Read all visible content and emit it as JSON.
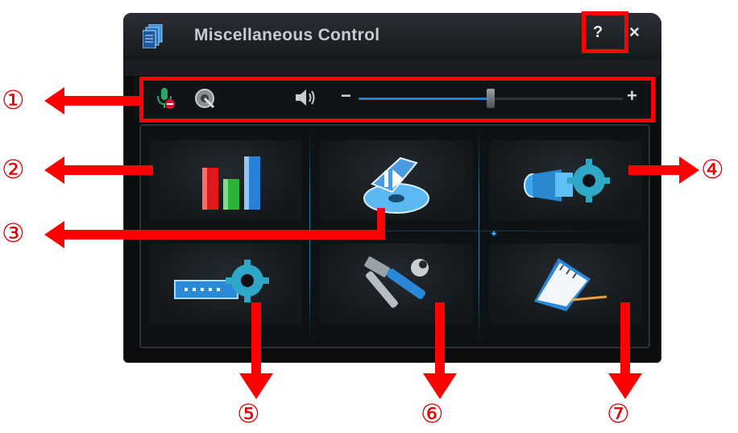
{
  "window": {
    "title": "Miscellaneous Control",
    "help_label": "?",
    "close_label": "×"
  },
  "toolbar": {
    "minus_label": "−",
    "plus_label": "+",
    "volume_level": 0.5
  },
  "callouts": {
    "c1": "①",
    "c2": "②",
    "c3": "③",
    "c4": "④",
    "c5": "⑤",
    "c6": "⑥",
    "c7": "⑦"
  },
  "icons": {
    "mic": "microphone-muted-icon",
    "record": "record-disc-icon",
    "speaker": "speaker-icon",
    "tile1": "bar-chart-icon",
    "tile2": "disc-backup-icon",
    "tile3": "camera-settings-icon",
    "tile4": "network-settings-icon",
    "tile5": "tools-icon",
    "tile6": "notebook-icon"
  },
  "colors": {
    "annotation": "#ff0000",
    "accent": "#1f7fe0"
  }
}
